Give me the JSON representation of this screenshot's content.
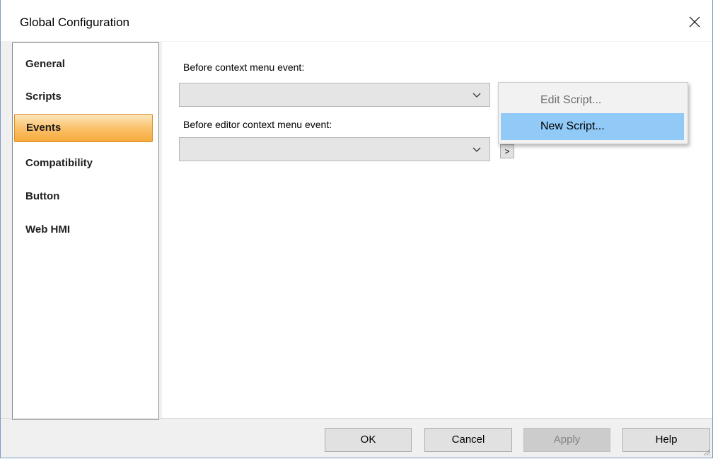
{
  "window": {
    "title": "Global Configuration"
  },
  "sidebar": {
    "items": [
      {
        "label": "General"
      },
      {
        "label": "Scripts"
      },
      {
        "label": "Events",
        "selected": true
      },
      {
        "label": "Compatibility"
      },
      {
        "label": "Button"
      },
      {
        "label": "Web HMI"
      }
    ]
  },
  "events": {
    "before_context_menu_label": "Before context menu event:",
    "before_context_menu_value": "",
    "before_editor_context_menu_label": "Before editor context menu event:",
    "before_editor_context_menu_value": "",
    "script_button_label": ">"
  },
  "context_menu": {
    "items": [
      {
        "label": "Edit Script...",
        "enabled": false
      },
      {
        "label": "New Script...",
        "enabled": true,
        "highlighted": true
      }
    ]
  },
  "footer": {
    "ok_label": "OK",
    "cancel_label": "Cancel",
    "apply_label": "Apply",
    "apply_enabled": false,
    "help_label": "Help"
  },
  "colors": {
    "selected_item_gradient_top": "#fde7bd",
    "selected_item_gradient_bottom": "#f7a93c",
    "menu_highlight": "#91c9f7",
    "window_border": "#7a9cc6"
  },
  "icons": {
    "close": "close-icon",
    "dropdown": "chevron-down-icon",
    "resize": "resize-grip-icon"
  }
}
